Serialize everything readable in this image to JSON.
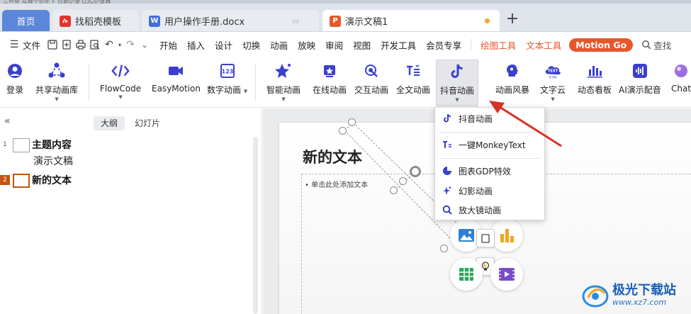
{
  "top_strip_text": "三合会    从哪个农民下    日期记录    LOG记录器",
  "tabs": {
    "home": "首页",
    "daoke": "找稻壳模板",
    "doc": "用户操作手册.docx",
    "active": "演示文稿1"
  },
  "menubar": {
    "file": "文件",
    "items": [
      "开始",
      "插入",
      "设计",
      "切换",
      "动画",
      "放映",
      "审阅",
      "视图",
      "开发工具",
      "会员专享"
    ],
    "drawing_tools": "绘图工具",
    "text_tools": "文本工具",
    "motion_go": "Motion Go",
    "search": "查找"
  },
  "ribbon": {
    "login": "登录",
    "shared_anim_lib": "共享动画库",
    "flowcode": "FlowCode",
    "easymotion": "EasyMotion",
    "digital_anim": "数字动画",
    "smart_anim": "智能动画",
    "online_anim": "在线动画",
    "interactive_anim": "交互动画",
    "fulltext_anim": "全文动画",
    "douyin_anim": "抖音动画",
    "anim_storm": "动画风暴",
    "text_cloud": "文字云",
    "dynamic_board": "动态看板",
    "ai_dubbing": "AI演示配音",
    "chat": "Chat"
  },
  "left_panel": {
    "tab_outline": "大纲",
    "tab_slides": "幻灯片",
    "outline": [
      {
        "num": "1",
        "title": "主题内容",
        "sub": "演示文稿"
      },
      {
        "num": "2",
        "title": "新的文本",
        "sub": ""
      }
    ]
  },
  "slide": {
    "title": "新的文本",
    "body_placeholder": "单击此处添加文本"
  },
  "dropdown": {
    "items": [
      "抖音动画",
      "一键MonkeyText",
      "图表GDP特效",
      "幻影动画",
      "放大镜动画"
    ]
  },
  "watermark": {
    "text": "极光下载站",
    "url": "www.xz7.com"
  },
  "colors": {
    "accent_blue": "#5b86d9",
    "orange": "#e8562b",
    "purple": "#4a3ccf",
    "arrow_red": "#d9302a"
  }
}
